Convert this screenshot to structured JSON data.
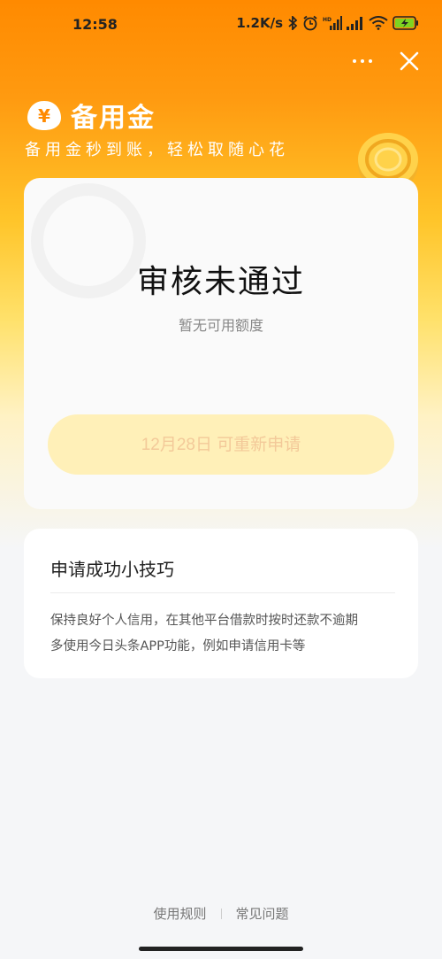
{
  "status_bar": {
    "time": "12:58",
    "network_speed": "1.2K/s",
    "icons": [
      "bluetooth-icon",
      "alarm-icon",
      "hd-signal-icon",
      "signal-icon",
      "wifi-icon",
      "battery-charging-icon"
    ]
  },
  "header": {
    "brand_title": "备用金",
    "brand_logo_symbol": "¥",
    "slogan": "备用金秒到账，轻松取随心花"
  },
  "status_card": {
    "title": "审核未通过",
    "subtitle": "暂无可用额度",
    "reapply_button_label": "12月28日 可重新申请"
  },
  "tips_card": {
    "title": "申请成功小技巧",
    "lines": [
      "保持良好个人信用，在其他平台借款时按时还款不逾期",
      "多使用今日头条APP功能，例如申请信用卡等"
    ]
  },
  "footer": {
    "links": [
      "使用规则",
      "常见问题"
    ]
  },
  "colors": {
    "brand_orange": "#ff8a00",
    "button_bg": "#fff0b8",
    "button_text": "#f3c999"
  }
}
